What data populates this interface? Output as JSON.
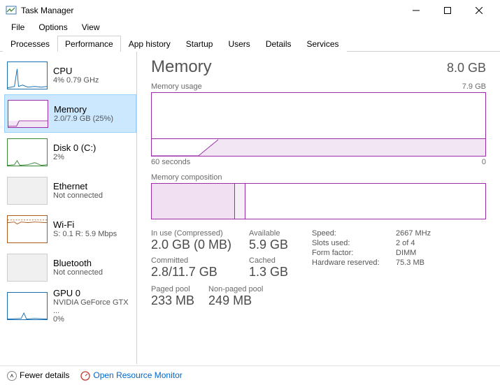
{
  "window": {
    "title": "Task Manager"
  },
  "menu": {
    "file": "File",
    "options": "Options",
    "view": "View"
  },
  "tabs": {
    "processes": "Processes",
    "performance": "Performance",
    "app_history": "App history",
    "startup": "Startup",
    "users": "Users",
    "details": "Details",
    "services": "Services"
  },
  "sidebar": {
    "items": [
      {
        "title": "CPU",
        "sub": "4% 0.79 GHz"
      },
      {
        "title": "Memory",
        "sub": "2.0/7.9 GB (25%)"
      },
      {
        "title": "Disk 0 (C:)",
        "sub": "2%"
      },
      {
        "title": "Ethernet",
        "sub": "Not connected"
      },
      {
        "title": "Wi-Fi",
        "sub": "S: 0.1 R: 5.9 Mbps"
      },
      {
        "title": "Bluetooth",
        "sub": "Not connected"
      },
      {
        "title": "GPU 0",
        "sub": "NVIDIA GeForce GTX ...",
        "sub2": "0%"
      }
    ]
  },
  "main": {
    "title": "Memory",
    "capacity": "8.0 GB",
    "usage_label": "Memory usage",
    "usage_max": "7.9 GB",
    "scale_left": "60 seconds",
    "scale_right": "0",
    "comp_label": "Memory composition",
    "stats": {
      "in_use_label": "In use (Compressed)",
      "in_use": "2.0 GB (0 MB)",
      "available_label": "Available",
      "available": "5.9 GB",
      "committed_label": "Committed",
      "committed": "2.8/11.7 GB",
      "cached_label": "Cached",
      "cached": "1.3 GB",
      "paged_label": "Paged pool",
      "paged": "233 MB",
      "nonpaged_label": "Non-paged pool",
      "nonpaged": "249 MB"
    },
    "kv": {
      "speed_l": "Speed:",
      "speed_v": "2667 MHz",
      "slots_l": "Slots used:",
      "slots_v": "2 of 4",
      "form_l": "Form factor:",
      "form_v": "DIMM",
      "hw_l": "Hardware reserved:",
      "hw_v": "75.3 MB"
    }
  },
  "footer": {
    "fewer": "Fewer details",
    "resmon": "Open Resource Monitor"
  },
  "chart_data": {
    "type": "area",
    "title": "Memory usage",
    "ylabel": "GB",
    "ylim": [
      0,
      7.9
    ],
    "xlabel": "seconds",
    "x": [
      60,
      50,
      40,
      30,
      20,
      10,
      0
    ],
    "values": [
      0,
      0,
      2.0,
      2.0,
      2.0,
      2.0,
      2.0
    ],
    "series_description": "flat at 0 for first ~20%, ramp to ~2.0 GB, then flat"
  }
}
